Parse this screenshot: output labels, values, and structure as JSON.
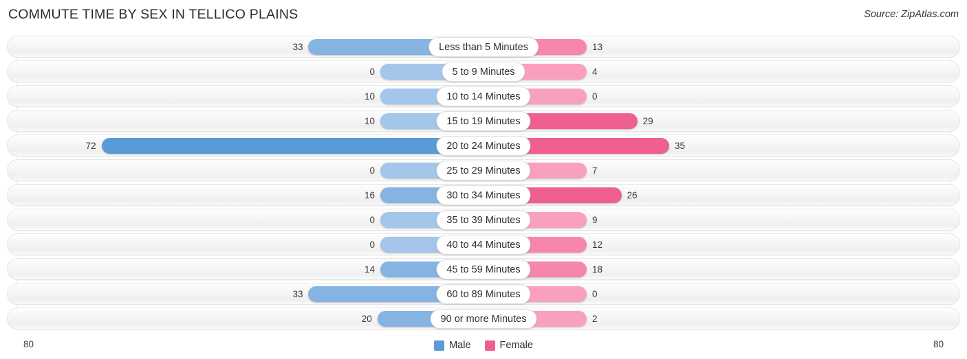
{
  "header": {
    "title": "COMMUTE TIME BY SEX IN TELLICO PLAINS",
    "source": "Source: ZipAtlas.com"
  },
  "axis": {
    "left_max_label": "80",
    "right_max_label": "80"
  },
  "legend": {
    "items": [
      {
        "label": "Male",
        "color": "#5b9bd5"
      },
      {
        "label": "Female",
        "color": "#ee5f8e"
      }
    ]
  },
  "colors": {
    "male_light": "#a3c6ea",
    "male_mid": "#85b4e2",
    "male_strong": "#5b9bd5",
    "female_light": "#f9a0c1",
    "female_mid": "#f786ae",
    "female_strong": "#f0608f",
    "track": "#f4f4f4",
    "text": "#3a3a3a"
  },
  "chart_data": {
    "type": "bar",
    "orientation": "horizontal-diverging",
    "title": "COMMUTE TIME BY SEX IN TELLICO PLAINS",
    "xlabel": "",
    "ylabel": "",
    "xlim": [
      80,
      80
    ],
    "grid": false,
    "legend_position": "bottom-center",
    "categories": [
      "Less than 5 Minutes",
      "5 to 9 Minutes",
      "10 to 14 Minutes",
      "15 to 19 Minutes",
      "20 to 24 Minutes",
      "25 to 29 Minutes",
      "30 to 34 Minutes",
      "35 to 39 Minutes",
      "40 to 44 Minutes",
      "45 to 59 Minutes",
      "60 to 89 Minutes",
      "90 or more Minutes"
    ],
    "series": [
      {
        "name": "Male",
        "side": "left",
        "values": [
          33,
          0,
          10,
          10,
          72,
          0,
          16,
          0,
          0,
          14,
          33,
          20
        ]
      },
      {
        "name": "Female",
        "side": "right",
        "values": [
          13,
          4,
          0,
          29,
          35,
          7,
          26,
          9,
          12,
          18,
          0,
          2
        ]
      }
    ]
  }
}
